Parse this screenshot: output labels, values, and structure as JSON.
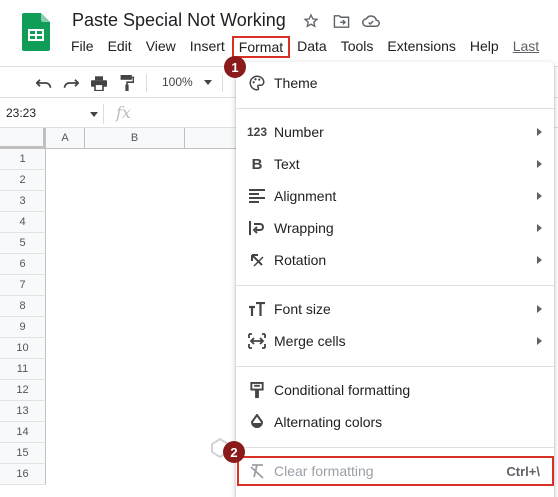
{
  "document": {
    "title": "Paste Special Not Working"
  },
  "menubar": {
    "items": [
      "File",
      "Edit",
      "View",
      "Insert",
      "Format",
      "Data",
      "Tools",
      "Extensions",
      "Help"
    ],
    "last_edit": "Last"
  },
  "toolbar": {
    "zoom": "100%"
  },
  "formula_bar": {
    "cell_ref": "23:23",
    "fx_label": "fx"
  },
  "grid": {
    "columns": [
      "A",
      "B"
    ],
    "rows": [
      "1",
      "2",
      "3",
      "4",
      "5",
      "6",
      "7",
      "8",
      "9",
      "10",
      "11",
      "12",
      "13",
      "14",
      "15",
      "16"
    ]
  },
  "format_menu": {
    "items": [
      {
        "label": "Theme",
        "icon": "palette-icon",
        "submenu": false
      },
      {
        "label": "Number",
        "icon": "number-123-icon",
        "submenu": true
      },
      {
        "label": "Text",
        "icon": "bold-b-icon",
        "submenu": true
      },
      {
        "label": "Alignment",
        "icon": "align-left-icon",
        "submenu": true
      },
      {
        "label": "Wrapping",
        "icon": "wrap-text-icon",
        "submenu": true
      },
      {
        "label": "Rotation",
        "icon": "text-rotation-icon",
        "submenu": true
      },
      {
        "label": "Font size",
        "icon": "font-size-icon",
        "submenu": true
      },
      {
        "label": "Merge cells",
        "icon": "merge-cells-icon",
        "submenu": true
      },
      {
        "label": "Conditional formatting",
        "icon": "paint-roller-icon",
        "submenu": false
      },
      {
        "label": "Alternating colors",
        "icon": "droplet-icon",
        "submenu": false
      },
      {
        "label": "Clear formatting",
        "icon": "clear-format-icon",
        "submenu": false,
        "shortcut": "Ctrl+\\"
      }
    ]
  },
  "annotations": {
    "step1": "1",
    "step2": "2"
  },
  "watermark": "OfficeWheel",
  "colors": {
    "accent_red": "#d93025",
    "badge": "#8b1a1a",
    "sheets_green": "#0f9d58"
  }
}
